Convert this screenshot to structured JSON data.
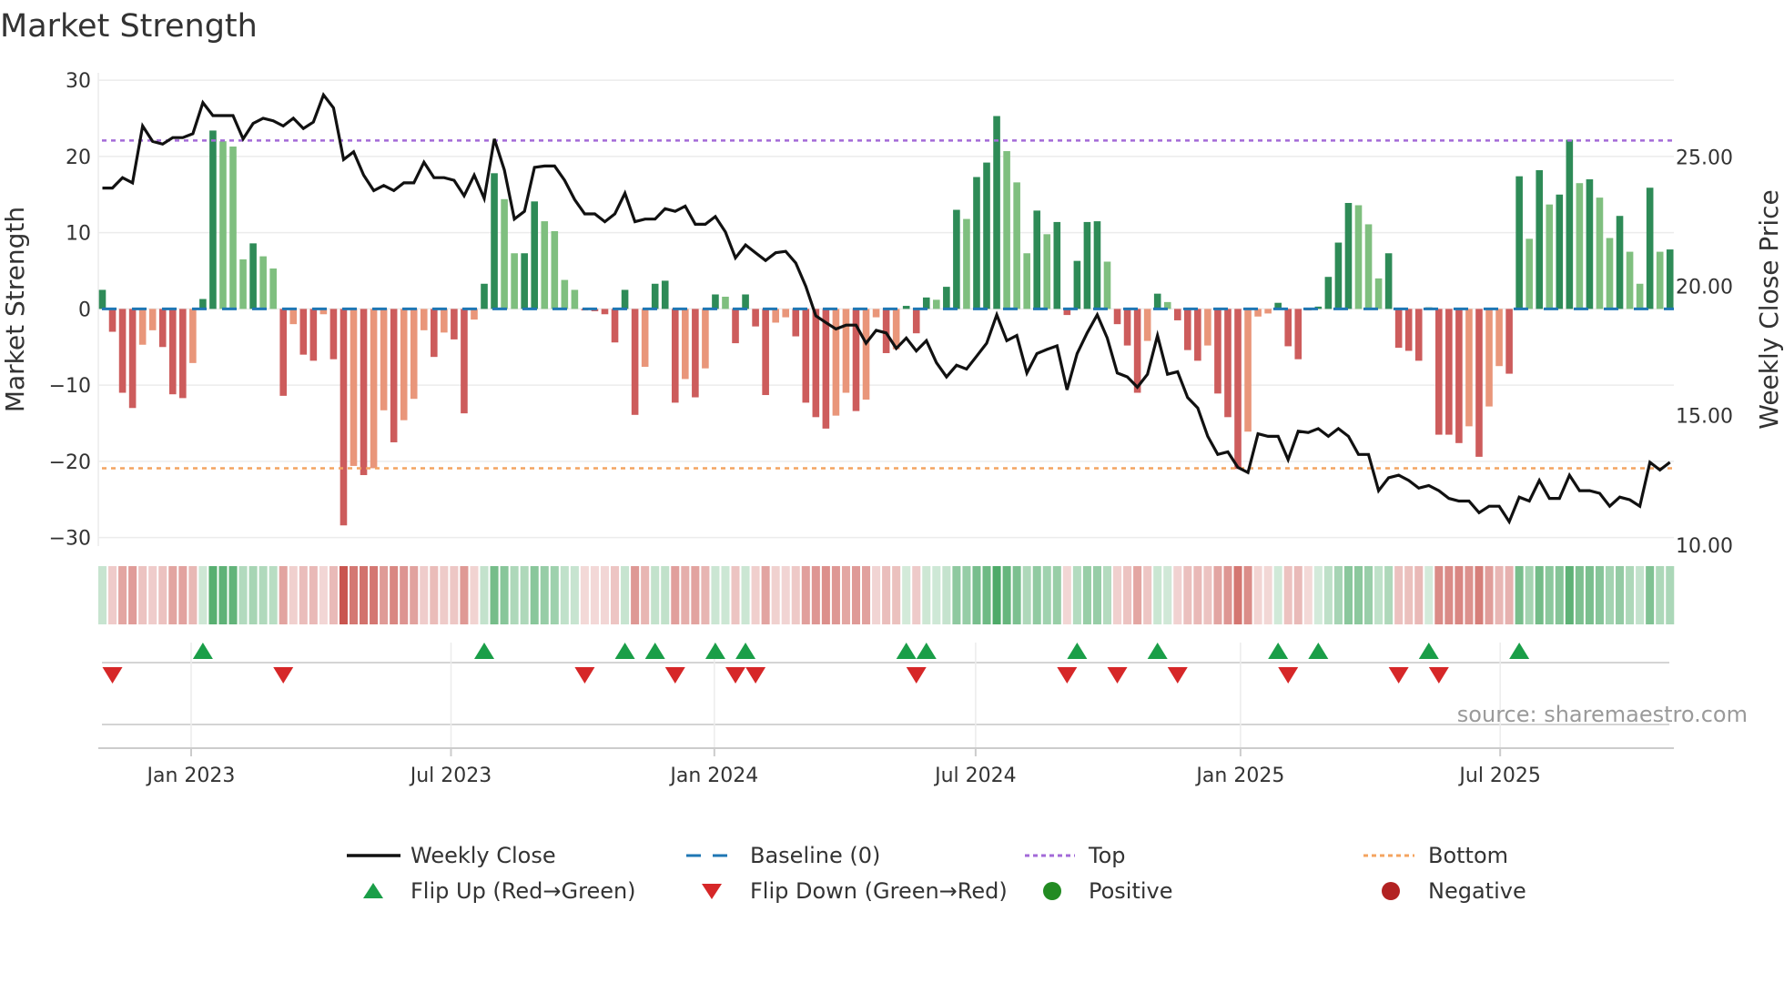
{
  "chart_data": {
    "type": "bar",
    "title": "Market Strength",
    "ylabel": "Market Strength",
    "y2label": "Weekly Close Price",
    "ylim": [
      -30,
      30
    ],
    "yticks": [
      30,
      20,
      10,
      0,
      -10,
      -20,
      -30
    ],
    "y2ticks": [
      "25.00",
      "20.00",
      "15.00",
      "10.00"
    ],
    "y2tick_values": [
      25,
      20,
      15,
      10
    ],
    "xticks": [
      {
        "label": "Jan 2023",
        "week": 8.83
      },
      {
        "label": "Jul 2023",
        "week": 34.69
      },
      {
        "label": "Jan 2024",
        "week": 60.9
      },
      {
        "label": "Jul 2024",
        "week": 86.9
      },
      {
        "label": "Jan 2025",
        "week": 113.26
      },
      {
        "label": "Jul 2025",
        "week": 139.1
      }
    ],
    "top_level": 22.1,
    "bottom_level": -20.9,
    "baseline": 0,
    "strength": [
      2.5,
      -3,
      -11,
      -13,
      -4.7,
      -2.8,
      -5,
      -11.2,
      -11.7,
      -7.1,
      1.3,
      23.4,
      22,
      21.3,
      6.5,
      8.6,
      6.9,
      5.3,
      -11.4,
      -2,
      -6,
      -6.8,
      -0.7,
      -6.6,
      -28.4,
      -20.6,
      -21.8,
      -20.9,
      -13.3,
      -17.5,
      -14.6,
      -11.8,
      -2.8,
      -6.3,
      -3.1,
      -4,
      -13.7,
      -1.4,
      3.3,
      17.8,
      14.4,
      7.3,
      7.3,
      14.1,
      11.5,
      10.2,
      3.8,
      2.5,
      -0.2,
      -0.3,
      -0.7,
      -4.4,
      2.5,
      -13.9,
      -7.6,
      3.3,
      3.7,
      -12.3,
      -9.2,
      -11.6,
      -7.8,
      1.9,
      1.6,
      -4.5,
      1.9,
      -2.3,
      -11.3,
      -1.8,
      -1.1,
      -3.6,
      -12.3,
      -14.2,
      -15.7,
      -14,
      -11,
      -13.4,
      -11.9,
      -1.1,
      -5.8,
      -5.3,
      0.4,
      -3.2,
      1.5,
      1.2,
      2.9,
      13,
      11.8,
      17.3,
      19.2,
      25.3,
      20.7,
      16.6,
      7.3,
      12.9,
      9.8,
      11.4,
      -0.8,
      6.3,
      11.4,
      11.5,
      6.2,
      -2,
      -4.8,
      -11,
      -4.2,
      2,
      0.9,
      -1.5,
      -5.4,
      -6.8,
      -4.8,
      -11.1,
      -14.2,
      -21,
      -16.1,
      -1,
      -0.6,
      0.8,
      -4.9,
      -6.6,
      -0.2,
      0.3,
      4.2,
      8.7,
      13.9,
      13.6,
      11.1,
      4,
      7.3,
      -5.1,
      -5.5,
      -6.8,
      0.2,
      -16.5,
      -16.5,
      -17.6,
      -15.4,
      -19.4,
      -12.8,
      -7.5,
      -8.5,
      17.4,
      9.2,
      18.2,
      13.7,
      15,
      22.2,
      16.5,
      17,
      14.6,
      9.3,
      12.2,
      7.5,
      3.3,
      15.9,
      7.5,
      7.8
    ],
    "strength_strong": [
      1,
      1,
      1,
      1,
      0,
      0,
      1,
      1,
      1,
      0,
      1,
      1,
      0,
      0,
      0,
      1,
      0,
      0,
      1,
      0,
      1,
      1,
      0,
      1,
      1,
      0,
      1,
      0,
      0,
      1,
      0,
      0,
      0,
      1,
      0,
      1,
      1,
      0,
      1,
      1,
      0,
      0,
      1,
      1,
      0,
      0,
      0,
      0,
      1,
      1,
      1,
      1,
      1,
      1,
      0,
      1,
      1,
      1,
      0,
      1,
      0,
      1,
      0,
      1,
      1,
      1,
      1,
      0,
      0,
      1,
      1,
      1,
      1,
      0,
      0,
      1,
      0,
      0,
      1,
      0,
      1,
      1,
      1,
      0,
      1,
      1,
      0,
      1,
      1,
      1,
      0,
      0,
      0,
      1,
      0,
      1,
      1,
      1,
      1,
      1,
      0,
      1,
      1,
      1,
      0,
      1,
      0,
      1,
      1,
      1,
      0,
      1,
      1,
      1,
      0,
      0,
      0,
      1,
      1,
      1,
      1,
      1,
      1,
      1,
      1,
      0,
      0,
      0,
      1,
      1,
      1,
      1,
      1,
      1,
      1,
      1,
      0,
      1,
      0,
      0,
      1,
      1,
      0,
      1,
      0,
      1,
      1,
      0,
      1,
      0,
      0,
      1,
      0,
      0,
      1,
      0,
      1
    ],
    "weekly_close": [
      23.8,
      23.8,
      24.2,
      24.0,
      26.2,
      25.6,
      25.5,
      25.75,
      25.75,
      25.9,
      27.1,
      26.6,
      26.6,
      26.6,
      25.7,
      26.3,
      26.5,
      26.4,
      26.2,
      26.5,
      26.1,
      26.35,
      27.4,
      26.9,
      24.9,
      25.2,
      24.3,
      23.7,
      23.9,
      23.7,
      24.0,
      24.0,
      24.8,
      24.2,
      24.2,
      24.1,
      23.5,
      24.3,
      23.4,
      25.7,
      24.5,
      22.6,
      22.9,
      24.6,
      24.65,
      24.65,
      24.1,
      23.35,
      22.8,
      22.8,
      22.5,
      22.8,
      23.6,
      22.5,
      22.6,
      22.6,
      23.0,
      22.9,
      23.1,
      22.4,
      22.4,
      22.7,
      22.1,
      21.1,
      21.6,
      21.3,
      21.0,
      21.3,
      21.35,
      20.9,
      20.0,
      18.86,
      18.6,
      18.35,
      18.5,
      18.5,
      17.8,
      18.3,
      18.2,
      17.6,
      18.0,
      17.5,
      17.9,
      17.05,
      16.5,
      16.95,
      16.8,
      17.3,
      17.8,
      18.9,
      17.9,
      18.1,
      16.65,
      17.4,
      17.56,
      17.7,
      16.0,
      17.4,
      18.2,
      18.9,
      18.0,
      16.65,
      16.5,
      16.1,
      16.6,
      18.1,
      16.6,
      16.7,
      15.7,
      15.3,
      14.2,
      13.5,
      13.6,
      13.0,
      12.8,
      14.3,
      14.2,
      14.2,
      13.3,
      14.4,
      14.35,
      14.5,
      14.2,
      14.5,
      14.2,
      13.5,
      13.5,
      12.1,
      12.6,
      12.7,
      12.5,
      12.2,
      12.3,
      12.1,
      11.8,
      11.7,
      11.7,
      11.25,
      11.5,
      11.5,
      10.9,
      11.85,
      11.7,
      12.5,
      11.8,
      11.8,
      12.7,
      12.1,
      12.1,
      12.0,
      11.5,
      11.85,
      11.75,
      11.5,
      13.2,
      12.9,
      13.2
    ],
    "flip_up_weeks": [
      10,
      38,
      52,
      55,
      61,
      64,
      80,
      82,
      97,
      105,
      117,
      121,
      132,
      141
    ],
    "flip_down_weeks": [
      1,
      18,
      48,
      57,
      63,
      65,
      81,
      96,
      101,
      107,
      118,
      129,
      133
    ],
    "legend": {
      "weekly_close": "Weekly Close",
      "baseline": "Baseline (0)",
      "top": "Top",
      "bottom": "Bottom",
      "flip_up": "Flip Up (Red→Green)",
      "flip_down": "Flip Down (Green→Red)",
      "positive": "Positive",
      "negative": "Negative",
      "placement": "bottom"
    },
    "source": "source: sharemaestro.com"
  },
  "colors": {
    "green_strong": "#2e8b57",
    "green_weak": "#7fbf7f",
    "red_strong": "#cd5c5c",
    "red_weak": "#e9967a",
    "baseline": "#1f77b4",
    "top": "#a36ad8",
    "bottom": "#f4a460",
    "flip_up": "#1a9e48",
    "flip_down": "#d62728",
    "positive": "#228b22",
    "negative": "#b22222",
    "price": "#111111"
  }
}
